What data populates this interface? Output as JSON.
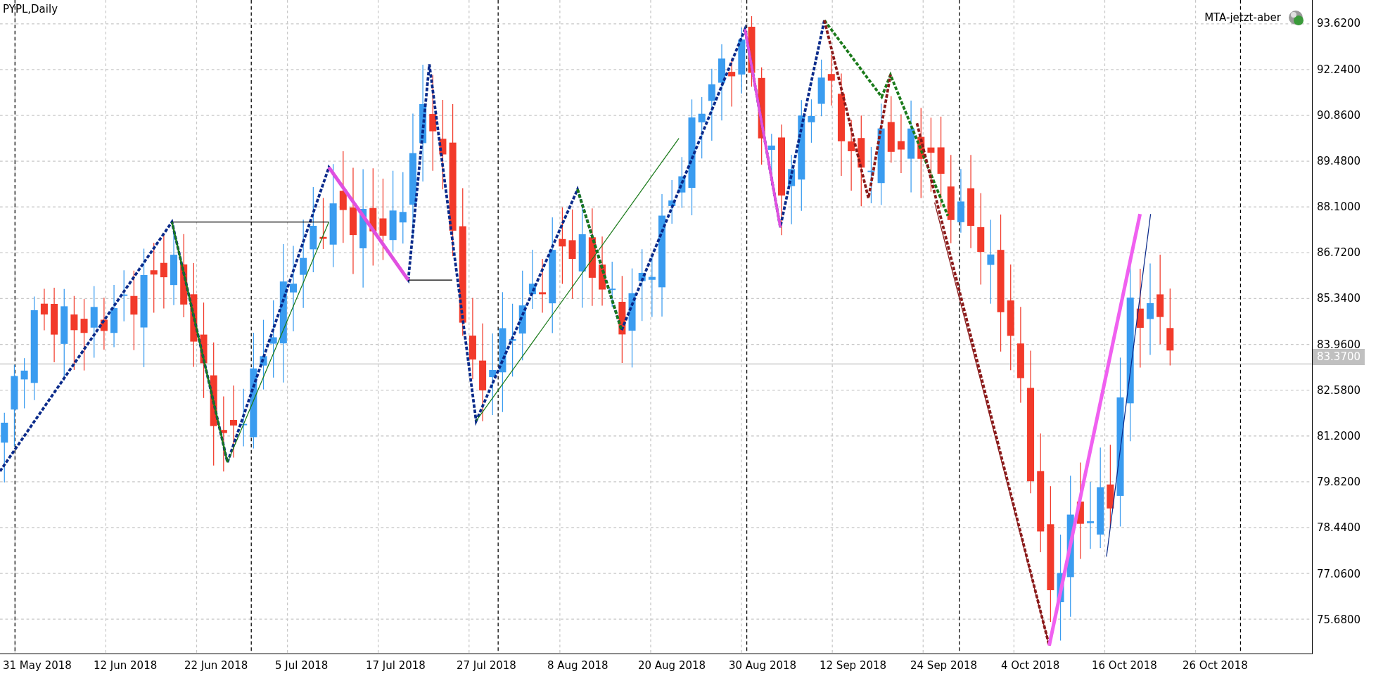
{
  "chart": {
    "symbol": "PYPL,Daily",
    "indicator": "MTA-jetzt-aber",
    "current_price": "83.3700",
    "price_ticks": [
      "93.6200",
      "92.2400",
      "90.8600",
      "89.4800",
      "88.1000",
      "86.7200",
      "85.3400",
      "83.9600",
      "82.5800",
      "81.2000",
      "79.8200",
      "78.4400",
      "77.0600",
      "75.6800"
    ],
    "date_ticks": [
      "31 May 2018",
      "12 Jun 2018",
      "22 Jun 2018",
      "5 Jul 2018",
      "17 Jul 2018",
      "27 Jul 2018",
      "8 Aug 2018",
      "20 Aug 2018",
      "30 Aug 2018",
      "12 Sep 2018",
      "24 Sep 2018",
      "4 Oct 2018",
      "16 Oct 2018",
      "26 Oct 2018"
    ]
  }
}
